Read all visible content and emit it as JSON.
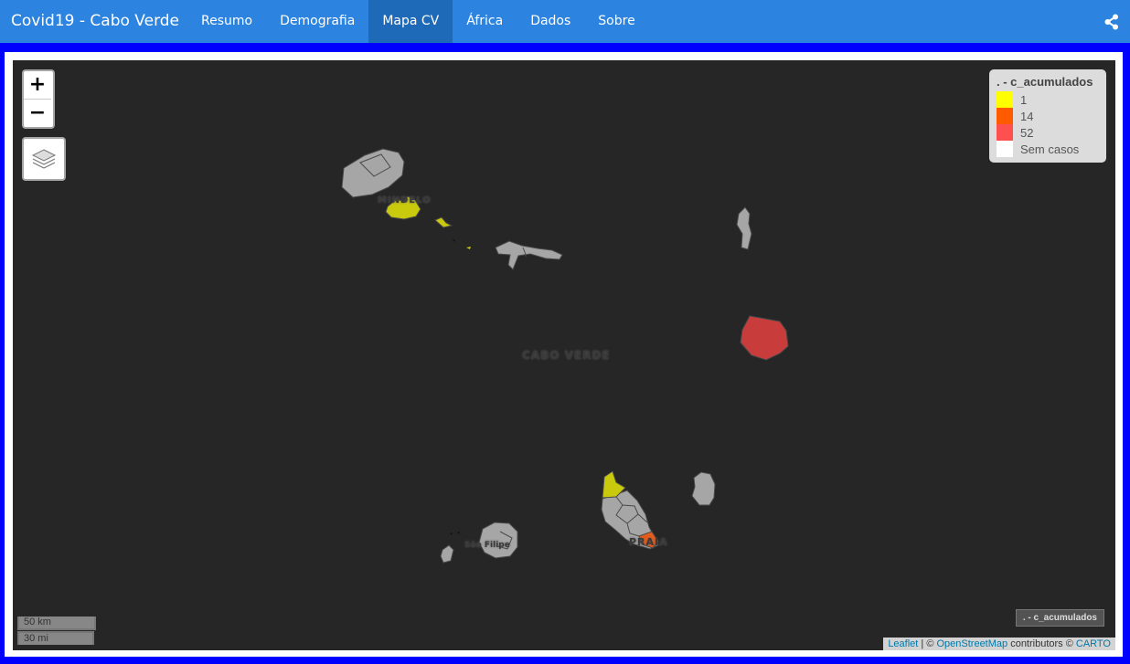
{
  "navbar": {
    "brand": "Covid19 - Cabo Verde",
    "tabs": [
      {
        "label": "Resumo",
        "active": false
      },
      {
        "label": "Demografia",
        "active": false
      },
      {
        "label": "Mapa CV",
        "active": true
      },
      {
        "label": "África",
        "active": false
      },
      {
        "label": "Dados",
        "active": false
      },
      {
        "label": "Sobre",
        "active": false
      }
    ],
    "share_icon": "share-icon"
  },
  "map": {
    "zoom_in": "+",
    "zoom_out": "−",
    "layers_icon": "layers-icon",
    "labels": {
      "country": "CABO VERDE",
      "mindelo": "MINDELO",
      "praia": "PRAIA",
      "sao_filipe": "São Filipe"
    },
    "legend": {
      "title": ". - c_acumulados",
      "items": [
        {
          "label": "1",
          "color": "#ffff00"
        },
        {
          "label": "14",
          "color": "#ff5a00"
        },
        {
          "label": "52",
          "color": "#ff5050"
        },
        {
          "label": "Sem casos",
          "color": "#ffffff"
        }
      ]
    },
    "layer_chip": ". - c_acumulados",
    "scale": {
      "km": "50 km",
      "mi": "30 mi"
    },
    "attribution": {
      "leaflet": "Leaflet",
      "sep1": " | © ",
      "osm": "OpenStreetMap",
      "contributors": " contributors © ",
      "carto": "CARTO"
    },
    "colors": {
      "no_cases": "#a6a6a6",
      "cases_1": "#c9c90e",
      "cases_14": "#e65c1c",
      "cases_52": "#c83c3c"
    }
  }
}
